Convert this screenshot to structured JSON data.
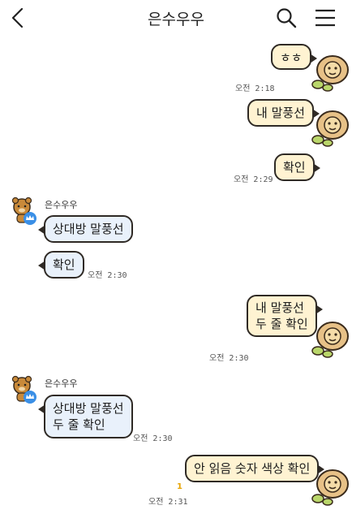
{
  "header": {
    "title": "은수우우",
    "back_icon": "chevron-left-icon",
    "search_icon": "search-icon",
    "menu_icon": "hamburger-menu-icon"
  },
  "chat": {
    "sender_name_1": "은수우우",
    "sender_name_2": "은수우우",
    "messages": [
      {
        "from": "me",
        "text": "ㅎㅎ",
        "time": "오전 2:18"
      },
      {
        "from": "me",
        "text": "내 말풍선",
        "time": ""
      },
      {
        "from": "me",
        "text": "확인",
        "time": "오전 2:29"
      },
      {
        "from": "them",
        "text": "상대방 말풍선",
        "time": ""
      },
      {
        "from": "them",
        "text": "확인",
        "time": "오전 2:30"
      },
      {
        "from": "me",
        "text_line1": "내 말풍선",
        "text_line2": "두 줄 확인",
        "time": "오전 2:30"
      },
      {
        "from": "them",
        "text_line1": "상대방 말풍선",
        "text_line2": "두 줄 확인",
        "time": "오전 2:30"
      },
      {
        "from": "me",
        "text": "안 읽음 숫자 색상 확인",
        "time": "오전 2:31",
        "unread": "1"
      }
    ]
  },
  "colors": {
    "my_bubble": "#fff3d2",
    "their_bubble": "#e9f1fb",
    "bubble_border": "#2f2a25",
    "unread_count": "#e7a300",
    "background": "#ffffff"
  }
}
